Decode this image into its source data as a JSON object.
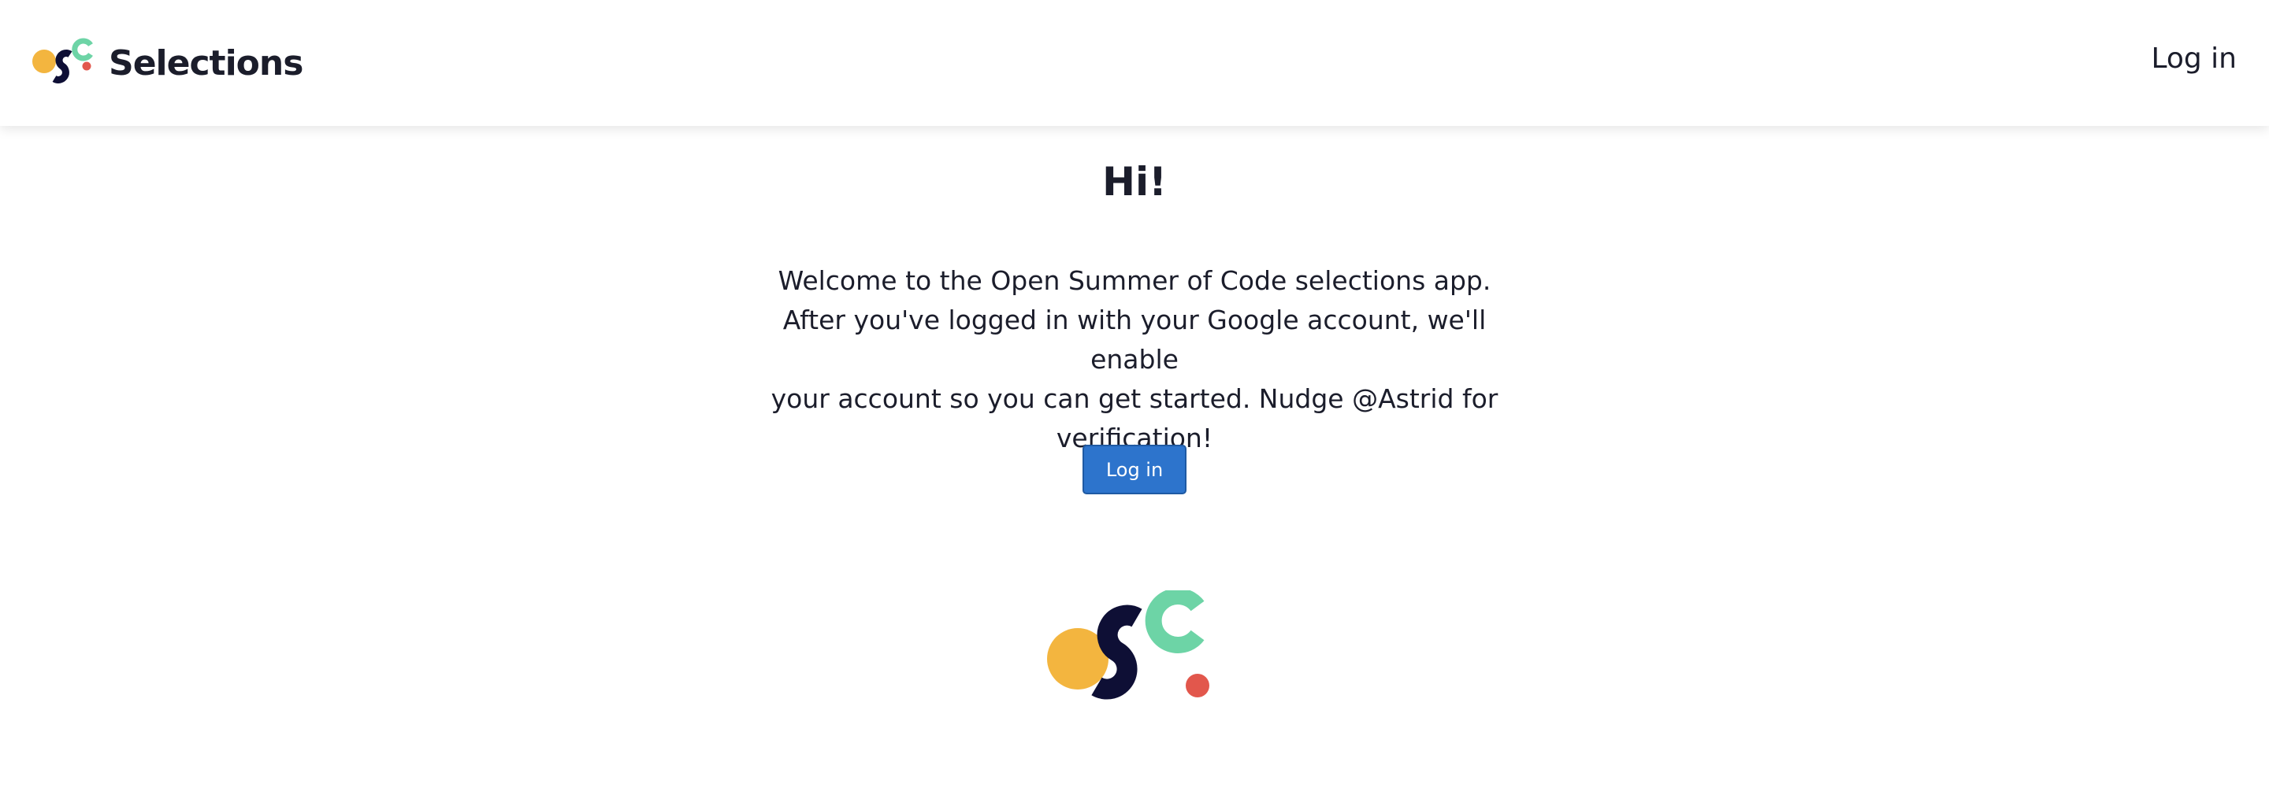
{
  "header": {
    "logo_icon": "osc-logo-icon",
    "brand_title": "Selections",
    "login_link": "Log in"
  },
  "main": {
    "greeting": "Hi!",
    "intro_lines": [
      "Welcome to the Open Summer of Code selections app.",
      "After you've logged in with your Google account, we'll enable",
      "your account so you can get started. Nudge @Astrid for",
      "verification!"
    ],
    "login_button": "Log in",
    "footer_logo_icon": "osc-logo-icon"
  },
  "colors": {
    "brand_yellow": "#f3b53f",
    "brand_navy": "#0e0f35",
    "brand_green": "#6dd4a6",
    "brand_red": "#e2574c",
    "button_blue": "#2d74cc",
    "text": "#1b1d2b"
  }
}
